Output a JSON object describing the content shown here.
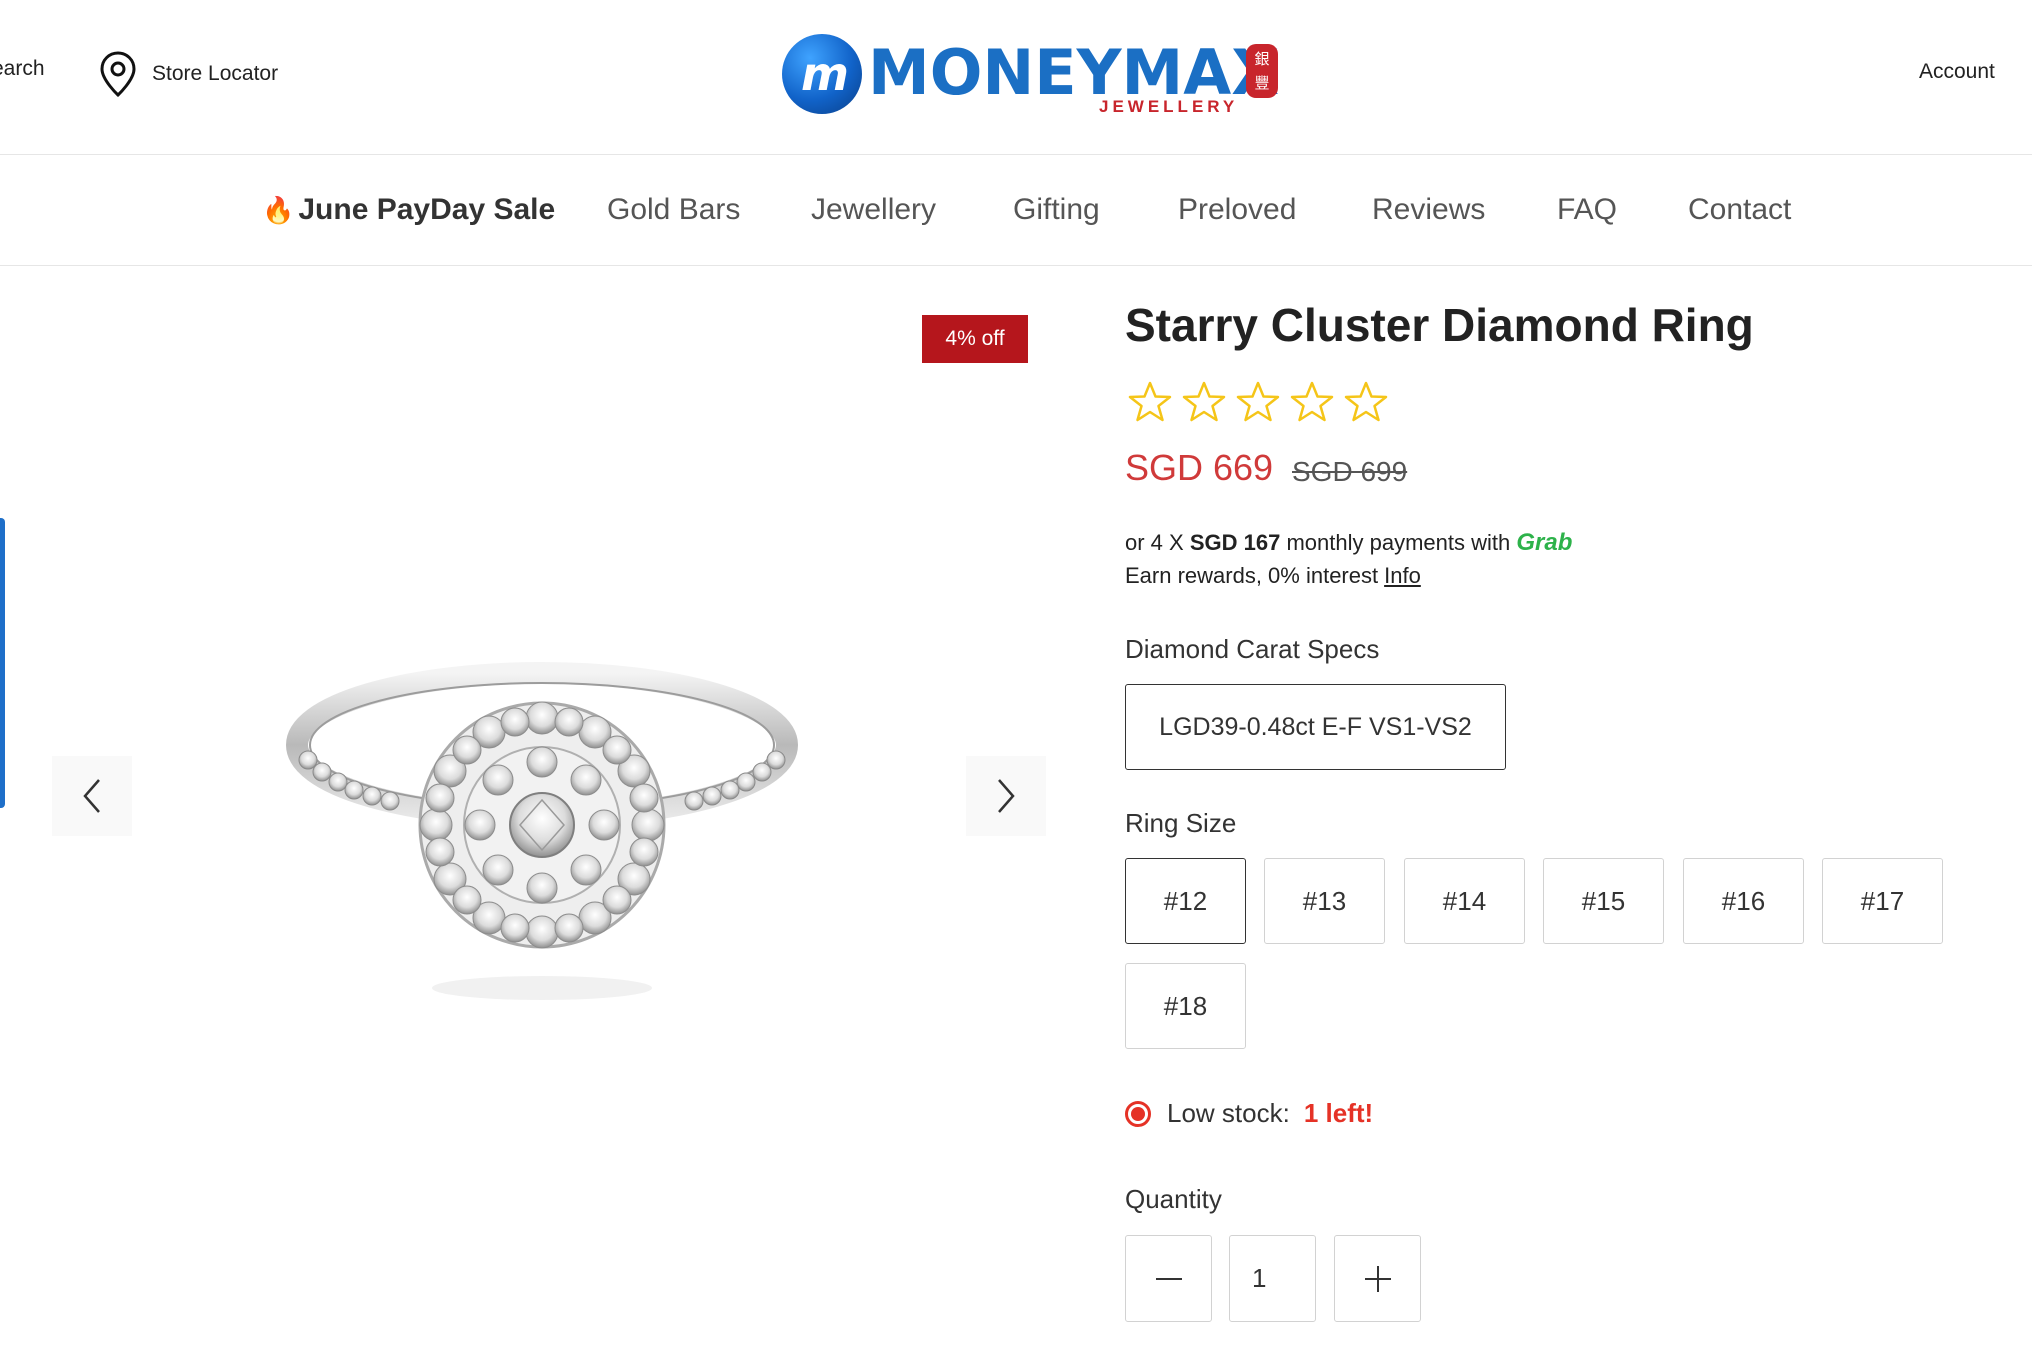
{
  "header": {
    "search_label": "earch",
    "store_locator_label": "Store Locator",
    "logo": {
      "mark": "m",
      "name": "MONEYMAX",
      "sub": "JEWELLERY",
      "seal_top": "銀",
      "seal_bottom": "豐"
    },
    "account_label": "Account"
  },
  "nav": {
    "items": [
      {
        "label": "June PayDay Sale",
        "icon": "flame-icon"
      },
      {
        "label": "Gold Bars"
      },
      {
        "label": "Jewellery"
      },
      {
        "label": "Gifting"
      },
      {
        "label": "Preloved"
      },
      {
        "label": "Reviews"
      },
      {
        "label": "FAQ"
      },
      {
        "label": "Contact"
      }
    ]
  },
  "gallery": {
    "badge": "4% off",
    "prev_icon": "chevron-left-icon",
    "next_icon": "chevron-right-icon"
  },
  "product": {
    "title": "Starry Cluster Diamond Ring",
    "rating": {
      "value": 0,
      "max": 5,
      "star_color": "#f5c518"
    },
    "price_now": "SGD 669",
    "price_was": "SGD 699",
    "installment": {
      "prefix": "or 4 X",
      "amount": "SGD 167",
      "middle": "monthly payments with",
      "provider": "Grab",
      "line2": "Earn rewards, 0% interest",
      "info_link": "Info"
    },
    "carat_label": "Diamond Carat Specs",
    "carat_option": "LGD39-0.48ct E-F VS1-VS2",
    "size_label": "Ring Size",
    "sizes": [
      "#12",
      "#13",
      "#14",
      "#15",
      "#16",
      "#17",
      "#18"
    ],
    "selected_size": "#12",
    "stock": {
      "label": "Low stock:",
      "count": "1 left!"
    },
    "quantity": {
      "label": "Quantity",
      "value": "1"
    }
  },
  "colors": {
    "accent_red": "#d03a3a",
    "badge_red": "#b5161c",
    "brand_blue": "#1b6fc4",
    "grab_green": "#2db24a"
  }
}
